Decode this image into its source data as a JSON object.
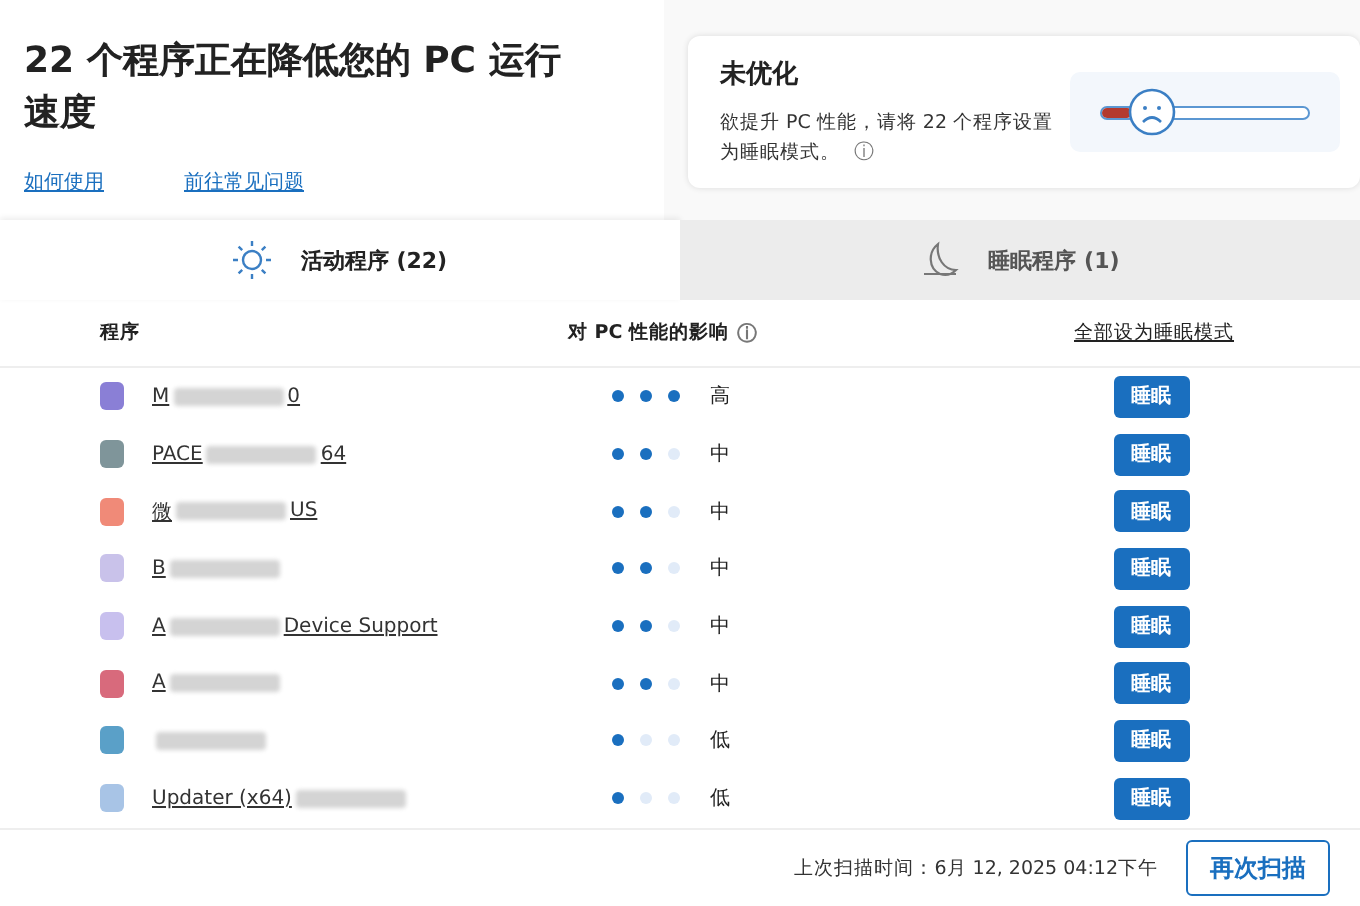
{
  "header": {
    "title": "22 个程序正在降低您的 PC 运行速度",
    "links": [
      "如何使用",
      "前往常见问题"
    ]
  },
  "status_card": {
    "title": "未优化",
    "description": "欲提升 PC 性能，请将 22 个程序设置为睡眠模式。",
    "info_icon": "ⓘ",
    "level": 0.15
  },
  "tabs": [
    {
      "label": "活动程序 (22)",
      "kind": "active",
      "selected": true
    },
    {
      "label": "睡眠程序 (1)",
      "kind": "sleep",
      "selected": false
    }
  ],
  "table": {
    "columns": [
      "程序",
      "对 PC 性能的影响",
      "全部设为睡眠模式"
    ],
    "info_icon": "ⓘ",
    "rows": [
      {
        "name_parts": [
          "M",
          "0"
        ],
        "color": "#8a7fd6",
        "stars": 3,
        "impact": "高",
        "action": "睡眠"
      },
      {
        "name_parts": [
          "PACE",
          "64"
        ],
        "color": "#7f959a",
        "stars": 2,
        "impact": "中",
        "action": "睡眠"
      },
      {
        "name_parts": [
          "微",
          "US"
        ],
        "color": "#f08a78",
        "stars": 2,
        "impact": "中",
        "action": "睡眠"
      },
      {
        "name_parts": [
          "B"
        ],
        "color": "#c9c2ea",
        "stars": 2,
        "impact": "中",
        "action": "睡眠"
      },
      {
        "name_parts": [
          "A",
          "Device Support"
        ],
        "color": "#c8c0ee",
        "stars": 2,
        "impact": "中",
        "action": "睡眠"
      },
      {
        "name_parts": [
          "A"
        ],
        "color": "#d86a7c",
        "stars": 2,
        "impact": "中",
        "action": "睡眠"
      },
      {
        "name_parts": [],
        "color": "#5aa0c8",
        "stars": 1,
        "impact": "低",
        "action": "睡眠"
      },
      {
        "name_parts": [
          "Updater (x64)"
        ],
        "color": "#a8c4e6",
        "stars": 1,
        "impact": "低",
        "action": "睡眠"
      }
    ]
  },
  "footer": {
    "last_scan": "上次扫描时间：6月 12, 2025 04:12下午",
    "button": "再次扫描"
  }
}
